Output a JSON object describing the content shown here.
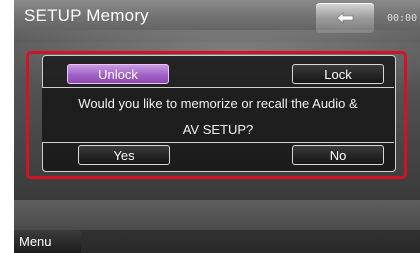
{
  "header": {
    "title": "SETUP Memory",
    "back_icon": "back-arrow-icon",
    "clock": "00:00"
  },
  "dialog": {
    "unlock_label": "Unlock",
    "lock_label": "Lock",
    "message_line1": "Would you like to memorize or recall the Audio &",
    "message_line2": "AV SETUP?",
    "yes_label": "Yes",
    "no_label": "No"
  },
  "footer": {
    "menu_label": "Menu"
  },
  "colors": {
    "highlight": "#d3122a",
    "active_button": "#a162c6"
  }
}
